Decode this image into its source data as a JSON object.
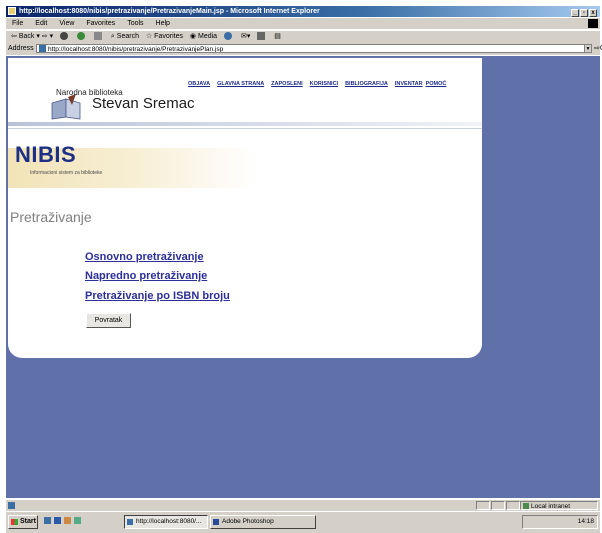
{
  "window": {
    "title": "http://localhost:8080/nibis/pretrazivanje/PretrazivanjeMain.jsp - Microsoft Internet Explorer"
  },
  "menu": [
    "File",
    "Edit",
    "View",
    "Favorites",
    "Tools",
    "Help"
  ],
  "toolbar": {
    "back": "Back",
    "search": "Search",
    "favorites": "Favorites",
    "media": "Media"
  },
  "address": {
    "label": "Address",
    "url": "http://localhost:8080/nibis/pretrazivanje/PretrazivanjePlan.jsp",
    "go": "Go"
  },
  "site": {
    "library_small": "Narodna biblioteka",
    "library_name": "Stevan Sremac",
    "nav": [
      "OBJAVA",
      "GLAVNA STRANA",
      "ZAPOSLENI",
      "KORISNICI",
      "BIBLIOGRAFIJA",
      "INVENTAR",
      "POMOĆ"
    ],
    "brand": "NIBIS",
    "brand_sub": "Informacioni sistem za biblioteke"
  },
  "main": {
    "title": "Pretraživanje",
    "links": [
      "Osnovno pretraživanje",
      "Napredno pretraživanje",
      "Pretraživanje po ISBN broju"
    ],
    "back_button": "Povratak"
  },
  "statusbar": {
    "zone": "Local intranet"
  },
  "taskbar": {
    "start": "Start",
    "tasks": [
      "http://localhost:8080/...",
      "Adobe Photoshop"
    ],
    "clock": "14:18"
  },
  "colors": {
    "background": "#6070a8",
    "link": "#2b2f9a",
    "brand": "#1e2f86"
  }
}
